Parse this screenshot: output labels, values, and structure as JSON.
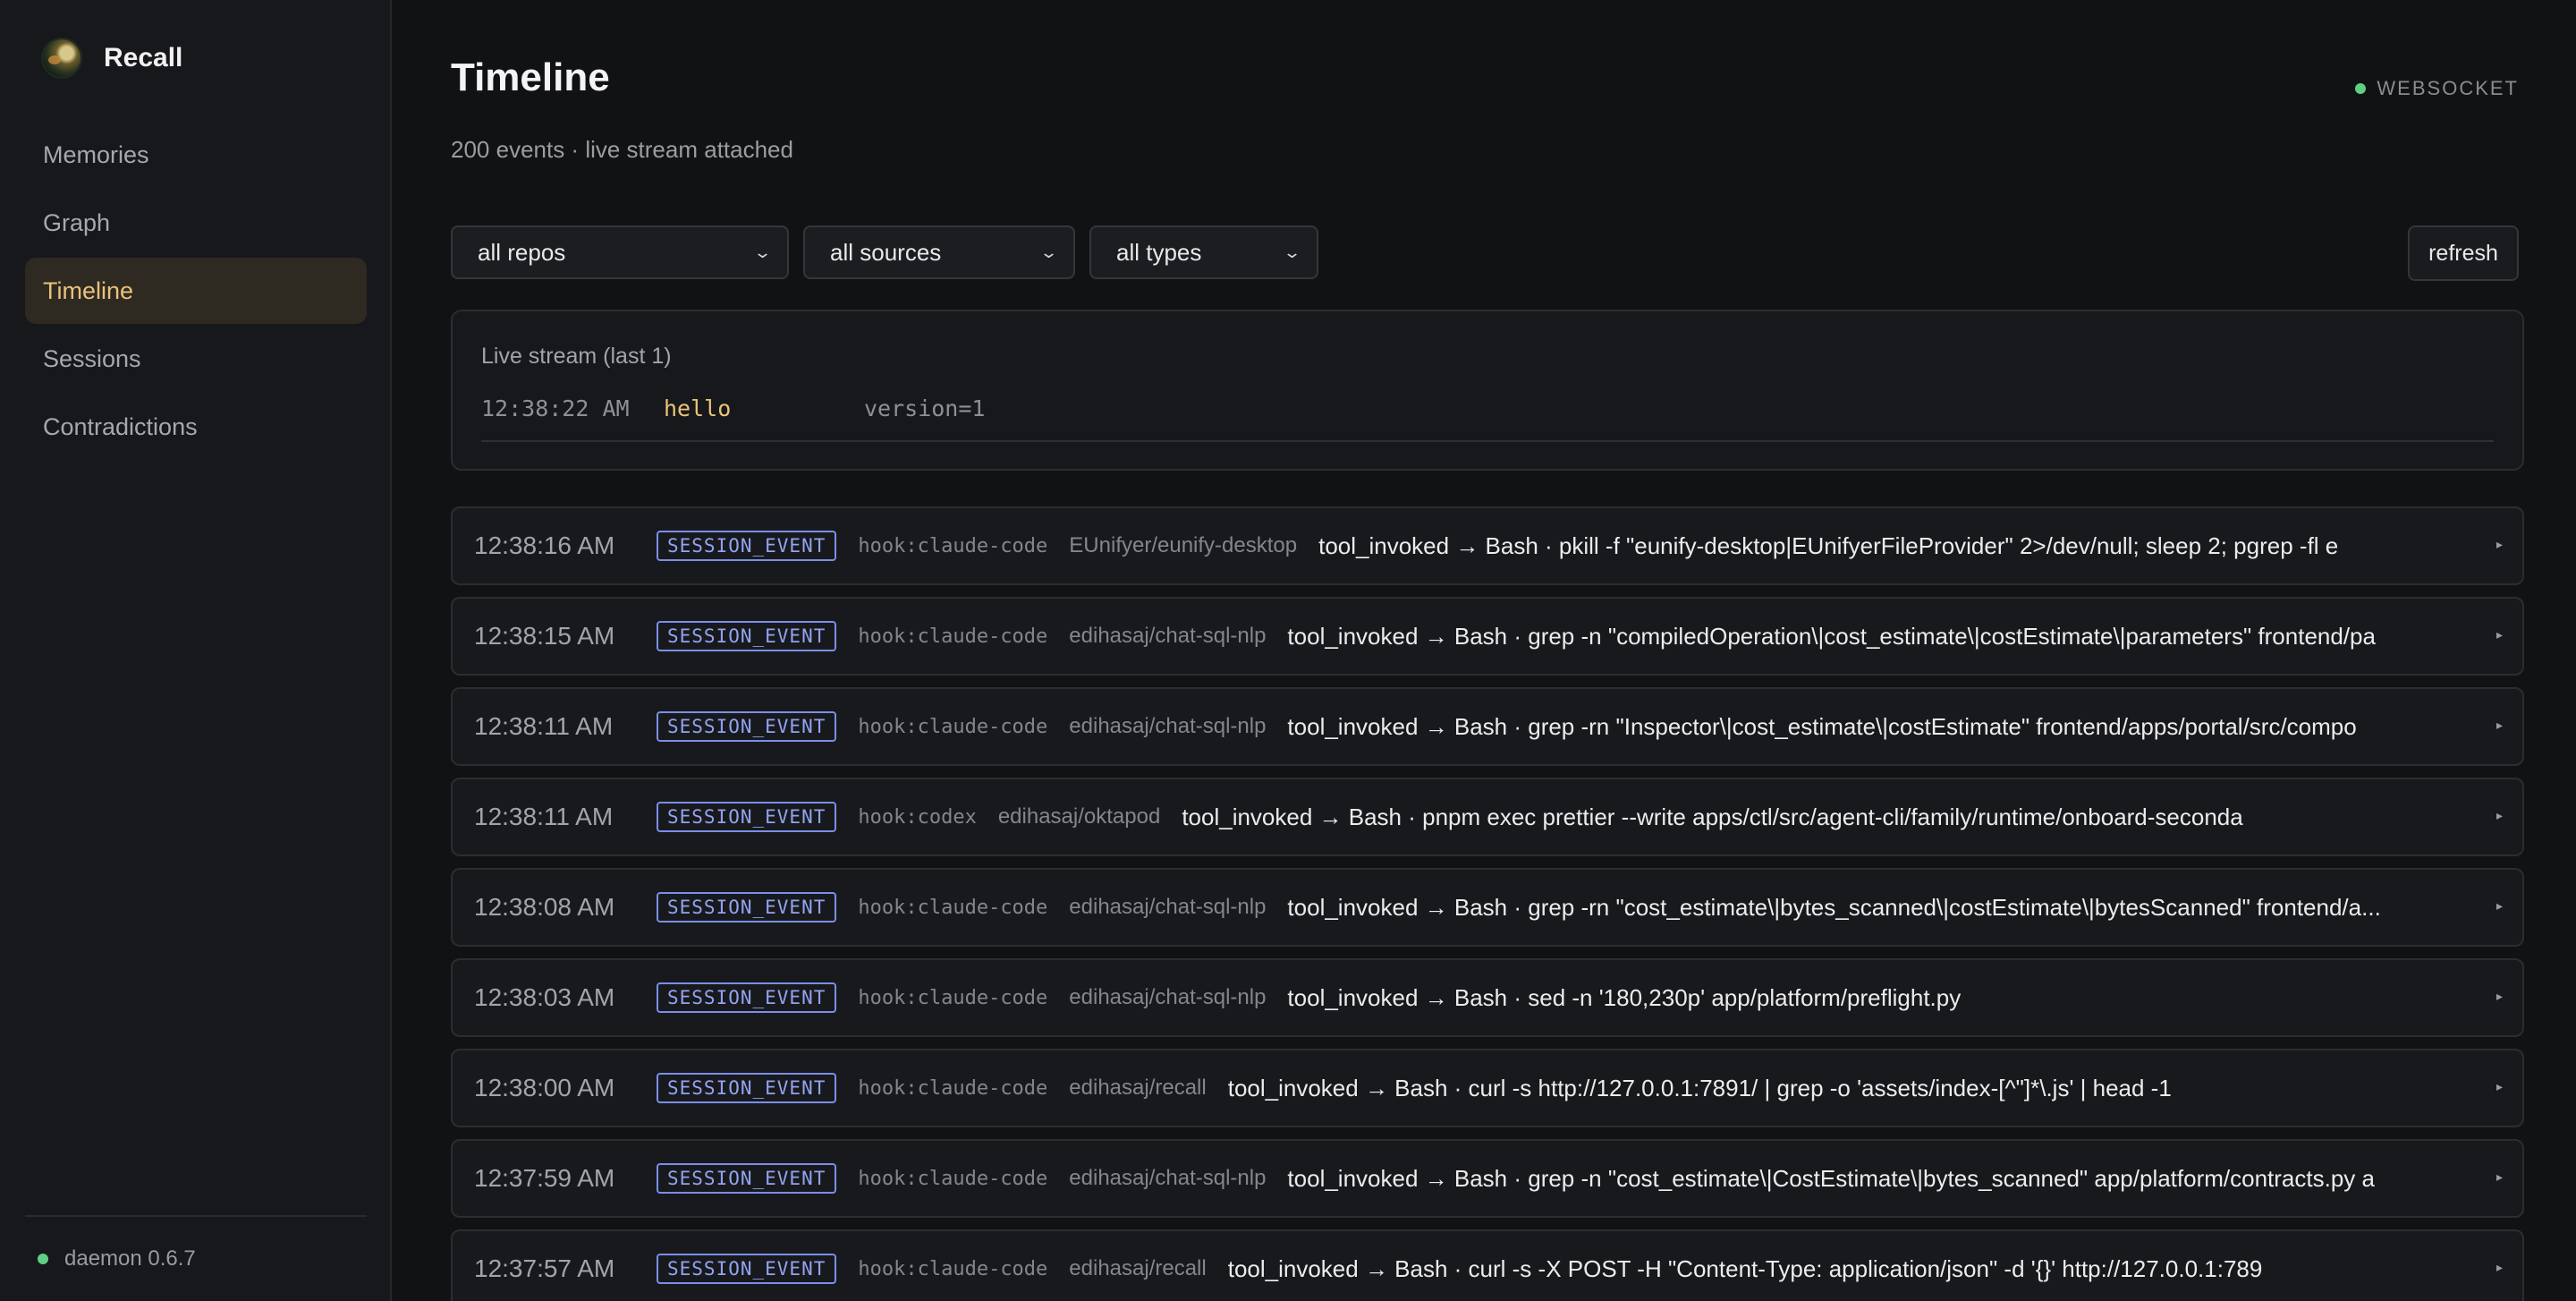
{
  "app": {
    "name": "Recall"
  },
  "sidebar": {
    "items": [
      {
        "label": "Memories",
        "active": false
      },
      {
        "label": "Graph",
        "active": false
      },
      {
        "label": "Timeline",
        "active": true
      },
      {
        "label": "Sessions",
        "active": false
      },
      {
        "label": "Contradictions",
        "active": false
      }
    ],
    "footer": {
      "daemon": "daemon 0.6.7",
      "status_color": "#5fcf86"
    }
  },
  "header": {
    "title": "Timeline",
    "subtitle": "200 events · live stream attached",
    "connection": "WEBSOCKET"
  },
  "filters": {
    "repo": "all repos",
    "source": "all sources",
    "type": "all types",
    "refresh": "refresh"
  },
  "live": {
    "title": "Live stream (last 1)",
    "rows": [
      {
        "time": "12:38:22 AM",
        "name": "hello",
        "kv": "version=1"
      }
    ]
  },
  "events": [
    {
      "time": "12:38:16 AM",
      "type": "SESSION_EVENT",
      "source": "hook:claude-code",
      "repo": "EUnifyer/eunify-desktop",
      "summary": "tool_invoked → Bash · pkill -f \"eunify-desktop|EUnifyerFileProvider\" 2>/dev/null; sleep 2; pgrep -fl e"
    },
    {
      "time": "12:38:15 AM",
      "type": "SESSION_EVENT",
      "source": "hook:claude-code",
      "repo": "edihasaj/chat-sql-nlp",
      "summary": "tool_invoked → Bash · grep -n \"compiledOperation\\|cost_estimate\\|costEstimate\\|parameters\" frontend/pa"
    },
    {
      "time": "12:38:11 AM",
      "type": "SESSION_EVENT",
      "source": "hook:claude-code",
      "repo": "edihasaj/chat-sql-nlp",
      "summary": "tool_invoked → Bash · grep -rn \"Inspector\\|cost_estimate\\|costEstimate\" frontend/apps/portal/src/compo"
    },
    {
      "time": "12:38:11 AM",
      "type": "SESSION_EVENT",
      "source": "hook:codex",
      "repo": "edihasaj/oktapod",
      "summary": "tool_invoked → Bash · pnpm exec prettier --write apps/ctl/src/agent-cli/family/runtime/onboard-seconda"
    },
    {
      "time": "12:38:08 AM",
      "type": "SESSION_EVENT",
      "source": "hook:claude-code",
      "repo": "edihasaj/chat-sql-nlp",
      "summary": "tool_invoked → Bash · grep -rn \"cost_estimate\\|bytes_scanned\\|costEstimate\\|bytesScanned\" frontend/a..."
    },
    {
      "time": "12:38:03 AM",
      "type": "SESSION_EVENT",
      "source": "hook:claude-code",
      "repo": "edihasaj/chat-sql-nlp",
      "summary": "tool_invoked → Bash · sed -n '180,230p' app/platform/preflight.py"
    },
    {
      "time": "12:38:00 AM",
      "type": "SESSION_EVENT",
      "source": "hook:claude-code",
      "repo": "edihasaj/recall",
      "summary": "tool_invoked → Bash · curl -s http://127.0.0.1:7891/ | grep -o 'assets/index-[^\"]*\\.js' | head -1"
    },
    {
      "time": "12:37:59 AM",
      "type": "SESSION_EVENT",
      "source": "hook:claude-code",
      "repo": "edihasaj/chat-sql-nlp",
      "summary": "tool_invoked → Bash · grep -n \"cost_estimate\\|CostEstimate\\|bytes_scanned\" app/platform/contracts.py a"
    },
    {
      "time": "12:37:57 AM",
      "type": "SESSION_EVENT",
      "source": "hook:claude-code",
      "repo": "edihasaj/recall",
      "summary": "tool_invoked → Bash · curl -s -X POST -H \"Content-Type: application/json\" -d '{}' http://127.0.0.1:789"
    }
  ]
}
